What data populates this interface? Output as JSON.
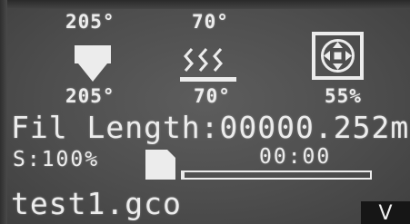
{
  "status": {
    "hotend_target": "205°",
    "bed_target": "70°",
    "hotend_current": "205°",
    "bed_current": "70°",
    "fan_speed": "55%",
    "fil_length": "Fil Length:00000.252m",
    "speed": "S:100%",
    "time": "00:00",
    "progress_fraction": 0.01,
    "filename": "test1.gco"
  },
  "icons": {
    "hotend": "nozzle-icon",
    "bed": "heated-bed-icon",
    "fan": "fan-icon",
    "sd": "sd-card-icon"
  },
  "corner_label": "V",
  "colors": {
    "lcd_background": "#505050",
    "lcd_foreground": "#ececec"
  }
}
